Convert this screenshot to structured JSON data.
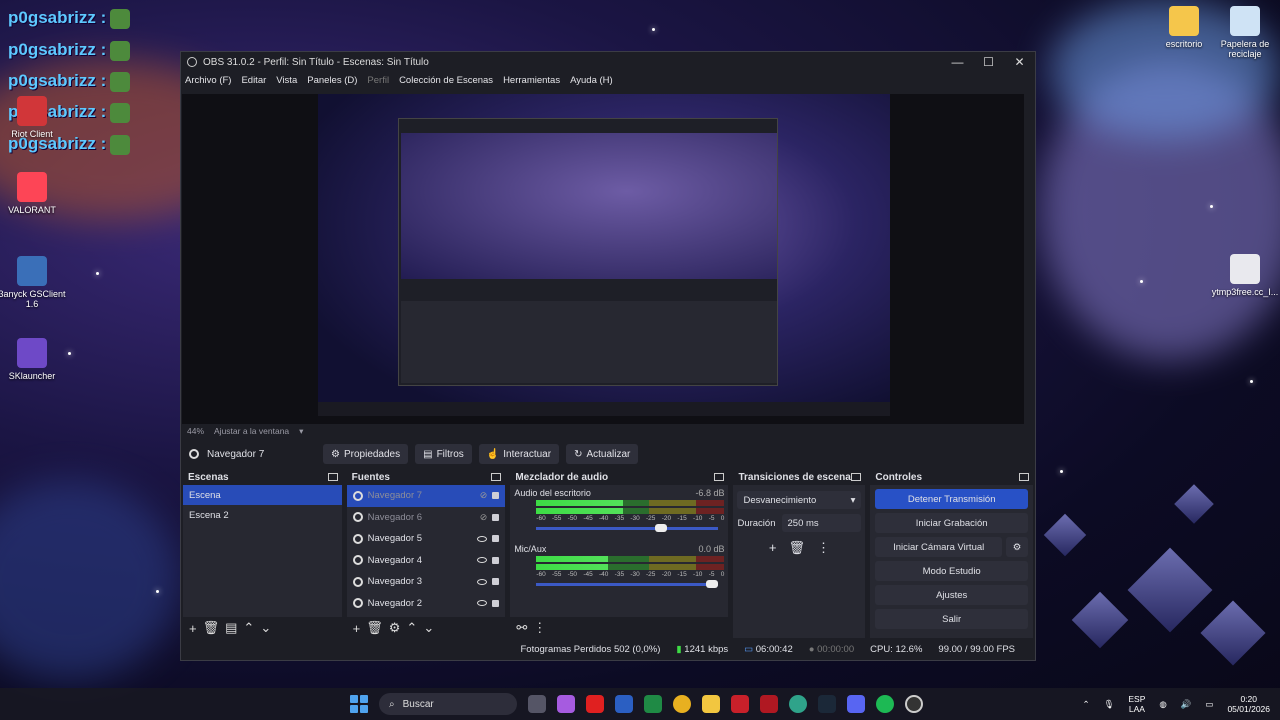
{
  "desktop": {
    "chat_name": "p0gsabrizz :",
    "icons_left": [
      "Riot Client",
      "VALORANT",
      "3anyck GSClient 1.6",
      "SKlauncher"
    ],
    "icons_right": [
      "escritorio",
      "Papelera de reciclaje",
      "ytmp3free.cc_I..."
    ]
  },
  "window": {
    "title": "OBS 31.0.2 - Perfil: Sin Título - Escenas: Sin Título",
    "controls": [
      "—",
      "☐",
      "✕"
    ]
  },
  "menu": [
    "Archivo (F)",
    "Editar",
    "Vista",
    "Paneles (D)",
    "Perfil",
    "Colección de Escenas",
    "Herramientas",
    "Ayuda (H)"
  ],
  "preview": {
    "zoom": "44%",
    "fit_label": "Ajustar a la ventana"
  },
  "source_toolbar": {
    "current_source": "Navegador 7",
    "properties": "Propiedades",
    "filters": "Filtros",
    "interact": "Interactuar",
    "refresh": "Actualizar"
  },
  "scenes": {
    "title": "Escenas",
    "items": [
      "Escena",
      "Escena 2"
    ]
  },
  "sources": {
    "title": "Fuentes",
    "items": [
      "Navegador 7",
      "Navegador 6",
      "Navegador 5",
      "Navegador 4",
      "Navegador 3",
      "Navegador 2"
    ]
  },
  "mixer": {
    "title": "Mezclador de audio",
    "channels": [
      {
        "name": "Audio del escritorio",
        "db": "-6.8 dB",
        "level": 0.46,
        "volume": 0.72
      },
      {
        "name": "Mic/Aux",
        "db": "0.0 dB",
        "level": 0.38,
        "volume": 1.0
      }
    ],
    "scale": [
      "-60",
      "-55",
      "-50",
      "-45",
      "-40",
      "-35",
      "-30",
      "-25",
      "-20",
      "-15",
      "-10",
      "-5",
      "0"
    ]
  },
  "transitions": {
    "title": "Transiciones de escena",
    "selected": "Desvanecimiento",
    "duration_label": "Duración",
    "duration_value": "250 ms"
  },
  "controls": {
    "title": "Controles",
    "stop_stream": "Detener Transmisión",
    "start_record": "Iniciar Grabación",
    "virtual_cam": "Iniciar Cámara Virtual",
    "studio_mode": "Modo Estudio",
    "settings": "Ajustes",
    "exit": "Salir"
  },
  "status": {
    "dropped": "Fotogramas Perdidos 502 (0,0%)",
    "bitrate": "1241 kbps",
    "stream_time": "06:00:42",
    "rec_time": "00:00:00",
    "cpu": "CPU: 12.6%",
    "fps": "99.00 / 99.00 FPS"
  },
  "taskbar": {
    "search": "Buscar",
    "lang_1": "ESP",
    "lang_2": "LAA",
    "time": "0:20",
    "date": "05/01/2026"
  },
  "colors": {
    "accent": "#284cb8",
    "panel": "#272831",
    "window_bg": "#1d1e25"
  }
}
